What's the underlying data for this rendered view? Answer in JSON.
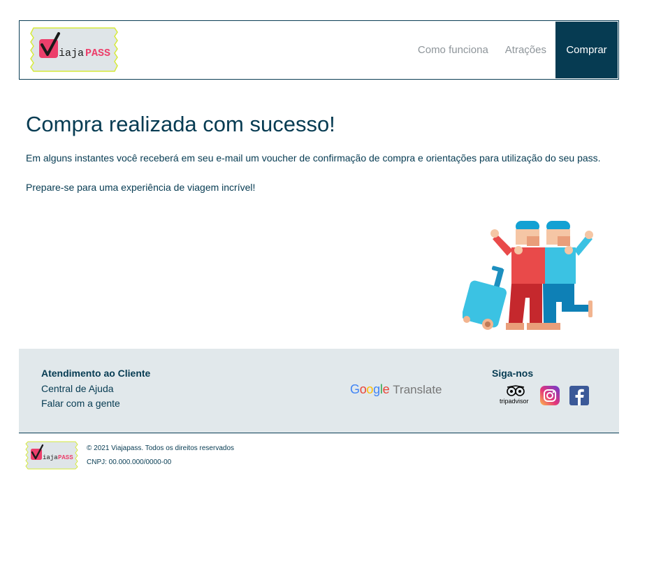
{
  "header": {
    "logo": {
      "text_viaja": "iaja",
      "text_pass": "PASS",
      "check_letter": "V"
    },
    "nav": {
      "how_it_works": "Como funciona",
      "attractions": "Atrações",
      "buy": "Comprar"
    }
  },
  "main": {
    "title": "Compra realizada com sucesso!",
    "paragraph_1": "Em alguns instantes você receberá em seu e-mail um voucher de confirmação de compra e orientações para utilização do seu pass.",
    "paragraph_2": "Prepare-se para uma experiência de viagem incrível!",
    "illustration": "travelers-with-suitcase-illustration"
  },
  "footer": {
    "support": {
      "heading": "Atendimento ao Cliente",
      "links": [
        "Central de Ajuda",
        "Falar com a gente"
      ]
    },
    "google_translate": {
      "google": "Google",
      "translate": "Translate"
    },
    "social": {
      "heading": "Siga-nos",
      "tripadvisor_text": "tripadvisor",
      "icons": [
        "tripadvisor-icon",
        "instagram-icon",
        "facebook-icon"
      ]
    }
  },
  "bottom": {
    "copyright": "© 2021 Viajapass. Todos os direitos reservados",
    "cnpj": "CNPJ: 00.000.000/0000-00"
  },
  "colors": {
    "primary": "#063b52",
    "footer_bg": "#e1e8eb",
    "nav_muted": "#8e959a",
    "logo_pink": "#ec3f6b",
    "logo_ticket": "#dfe5e8",
    "logo_ticket_edge": "#d6ea3a"
  }
}
